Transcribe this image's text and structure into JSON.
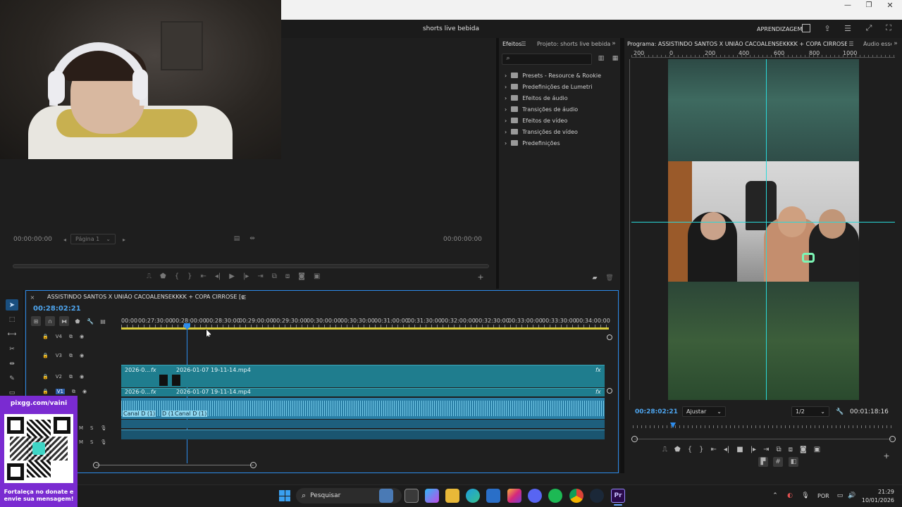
{
  "window": {
    "title": "shorts live bebida",
    "workspace_label": "APRENDIZAGEM",
    "controls": [
      "minimize",
      "maximize",
      "close"
    ]
  },
  "source_monitor": {
    "timecode_left": "00:00:00:00",
    "timecode_right": "00:00:00:00",
    "page_select": "Página 1"
  },
  "effects_panel": {
    "tab_effects": "Efeitos",
    "tab_project": "Projeto: shorts live bebida",
    "folders": [
      "Presets - Resource & Rookie",
      "Predefinições de Lumetri",
      "Efeitos de áudio",
      "Transições de áudio",
      "Efeitos de vídeo",
      "Transições de vídeo",
      "Predefinições"
    ]
  },
  "program_monitor": {
    "title": "Programa: ASSISTINDO SANTOS X UNIÃO CACOALENSEKKKK + COPA CIRROSE [ezRzblOFIM]",
    "audio_tab": "Áudio essen",
    "ruler_labels": [
      "200",
      "0",
      "200",
      "400",
      "600",
      "800",
      "1000"
    ],
    "timecode_current": "00:28:02:21",
    "fit_select": "Ajustar",
    "resolution_select": "1/2",
    "timecode_duration": "00:01:18:16"
  },
  "timeline": {
    "sequence_name": "ASSISTINDO SANTOS X UNIÃO CACOALENSEKKKK + COPA CIRROSE [ezRzblOFIM]",
    "timecode": "00:28:02:21",
    "ruler_times": [
      "00:00",
      "00:27:30:00",
      "00:28:00:00",
      "00:28:30:00",
      "00:29:00:00",
      "00:29:30:00",
      "00:30:00:00",
      "00:30:30:00",
      "00:31:00:00",
      "00:31:30:00",
      "00:32:00:00",
      "00:32:30:00",
      "00:33:00:00",
      "00:33:30:00",
      "00:34:00:00"
    ],
    "tracks": [
      "V4",
      "V3",
      "V2",
      "V1"
    ],
    "clip_short_v2": "2026-0...",
    "clip_v2_name": "2026-01-07 19-11-14.mp4",
    "clip_short_v1": "2026-0...",
    "clip_v1_name": "2026-01-07 19-11-14.mp4",
    "audio_labels": [
      "Canal D (1)",
      "D (1)",
      "Canal D (1)"
    ],
    "fx_label": "fx",
    "m_label": "M",
    "s_label": "S"
  },
  "overlay": {
    "url": "pixgg.com/vaini",
    "message": "Fortaleça no donate e envie sua mensagem!"
  },
  "taskbar": {
    "search_placeholder": "Pesquisar",
    "language": "POR",
    "time": "21:29",
    "date": "10/01/2026"
  },
  "colors": {
    "accent_blue": "#2d8ceb",
    "clip_teal": "#1f7d8e",
    "audio_blue": "#5bbde0",
    "ruler_yellow": "#d6c93a",
    "guide_cyan": "#2ad9d9"
  }
}
